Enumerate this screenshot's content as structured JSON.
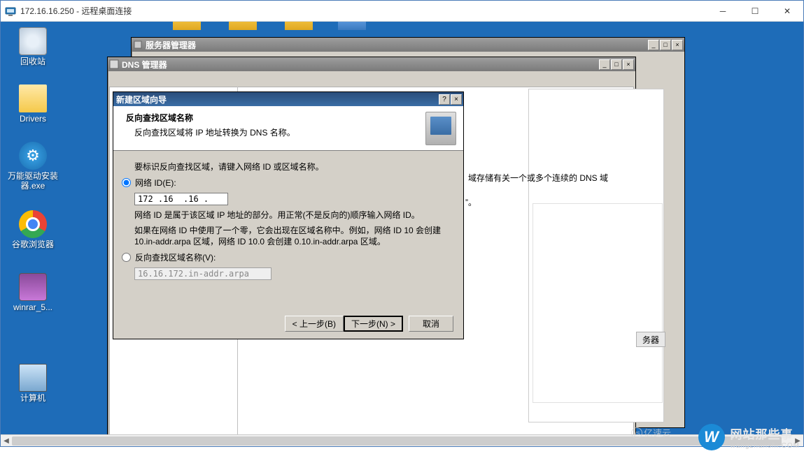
{
  "rdp": {
    "title": "172.16.16.250 - 远程桌面连接"
  },
  "desktop_icons": {
    "recycle": "回收站",
    "drivers": "Drivers",
    "wandrv": "万能驱动安装器.exe",
    "chrome": "谷歌浏览器",
    "winrar": "winrar_5...",
    "computer": "计算机"
  },
  "server_mgr": {
    "title": "服务器管理器"
  },
  "dns_mgr": {
    "title": "DNS 管理器",
    "body_line1": "域存储有关一个或多个连续的 DNS 域",
    "body_line2": "”。",
    "svc_button": "务器"
  },
  "wizard": {
    "title": "新建区域向导",
    "header": "反向查找区域名称",
    "subheader": "反向查找区域将 IP 地址转换为 DNS 名称。",
    "intro": "要标识反向查找区域，请键入网络 ID 或区域名称。",
    "radio_network": "网络 ID(E):",
    "ip_value": "172 .16  .16 .",
    "note1": "网络 ID 是属于该区域 IP 地址的部分。用正常(不是反向的)顺序输入网络 ID。",
    "note2": "如果在网络 ID 中使用了一个零，它会出现在区域名称中。例如，网络 ID 10 会创建 10.in-addr.arpa 区域，网络 ID 10.0 会创建 0.10.in-addr.arpa 区域。",
    "radio_zone": "反向查找区域名称(V):",
    "zone_value": "16.16.172.in-addr.arpa",
    "back": "< 上一步(B)",
    "next": "下一步(N) >",
    "cancel": "取消"
  },
  "watermark": {
    "text": "网站那些事",
    "sub": "wangzhanshi.COM",
    "yzy": "亿速云"
  }
}
